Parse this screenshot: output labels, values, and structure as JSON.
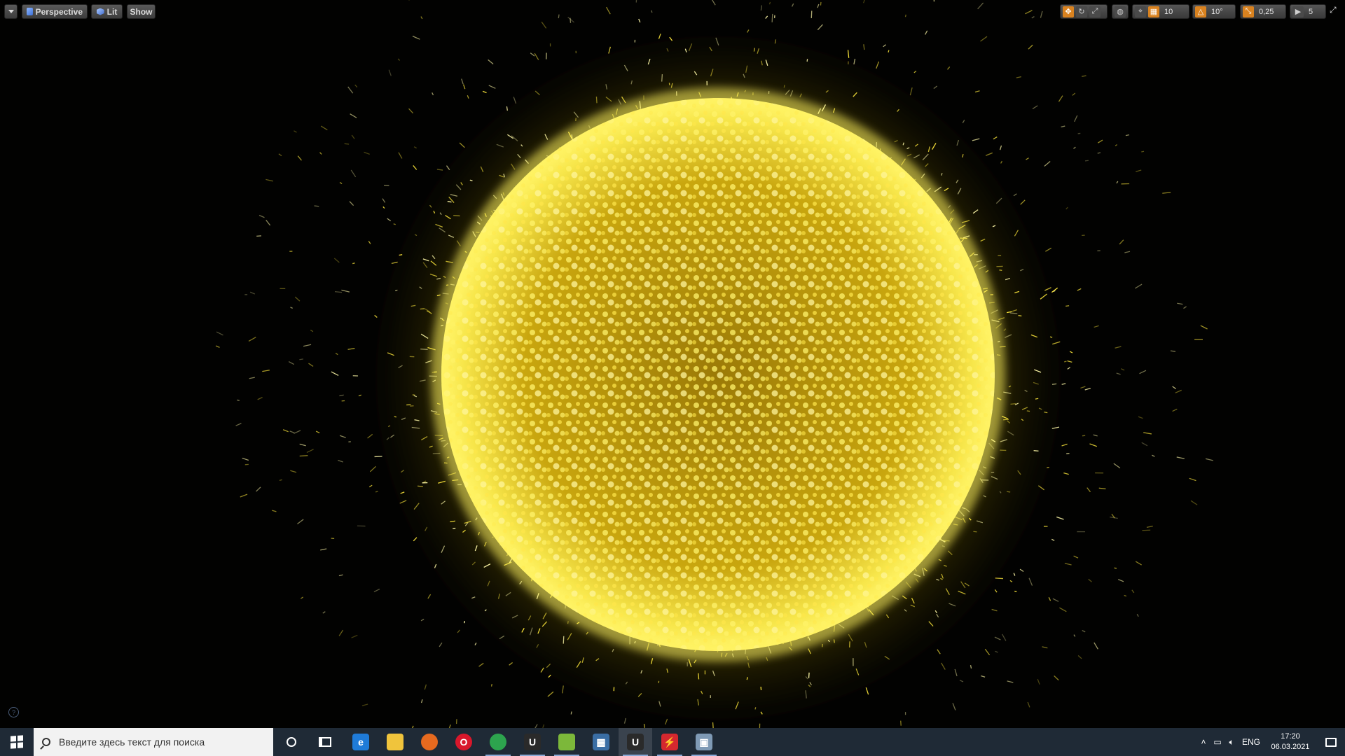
{
  "viewport": {
    "menu_icon": "chevron-down-icon",
    "perspective_label": "Perspective",
    "lit_label": "Lit",
    "show_label": "Show",
    "grid_snap_value": "10",
    "rotation_snap_value": "10°",
    "scale_snap_value": "0,25",
    "camera_speed_value": "5",
    "colors": {
      "toolbar_accent": "#d9821f",
      "particle_glow": "#fff15a",
      "particle_core": "#8a6a05"
    }
  },
  "taskbar": {
    "search_placeholder": "Введите здесь текст для поиска",
    "apps": [
      {
        "name": "edge-icon",
        "glyph": "e",
        "color": "#1f7bd8"
      },
      {
        "name": "file-explorer-icon",
        "glyph": "",
        "color": "#f0c43c"
      },
      {
        "name": "firefox-icon",
        "glyph": "",
        "color": "#e66a1f"
      },
      {
        "name": "opera-icon",
        "glyph": "O",
        "color": "#d9172b"
      },
      {
        "name": "chrome-icon",
        "glyph": "",
        "color": "#2da44e"
      },
      {
        "name": "unreal-engine-icon",
        "glyph": "U",
        "color": "#2a2a2a"
      },
      {
        "name": "pencil-app-icon",
        "glyph": "",
        "color": "#7cb83a"
      },
      {
        "name": "calculator-icon",
        "glyph": "▦",
        "color": "#3a6ea5"
      },
      {
        "name": "unreal-editor-icon",
        "glyph": "U",
        "color": "#2a2a2a"
      },
      {
        "name": "flash-app-icon",
        "glyph": "⚡",
        "color": "#d4282f"
      },
      {
        "name": "photo-viewer-icon",
        "glyph": "▣",
        "color": "#7f9ab5"
      }
    ],
    "language": "ENG",
    "time": "17:20",
    "date": "06.03.2021"
  }
}
